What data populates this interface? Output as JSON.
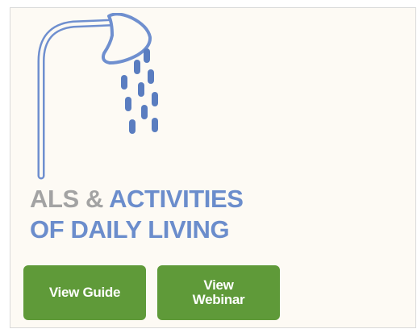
{
  "card": {
    "title_part1": "ALS & ",
    "title_part2": "ACTIVITIES",
    "title_line2": "OF DAILY LIVING",
    "icon": "shower-icon"
  },
  "buttons": {
    "guide_label": "View Guide",
    "webinar_label": "View Webinar"
  },
  "colors": {
    "gray_text": "#a3a3a3",
    "blue_text": "#6b8dcc",
    "button_green": "#5f9a39",
    "icon_blue": "#5a7dc0"
  }
}
